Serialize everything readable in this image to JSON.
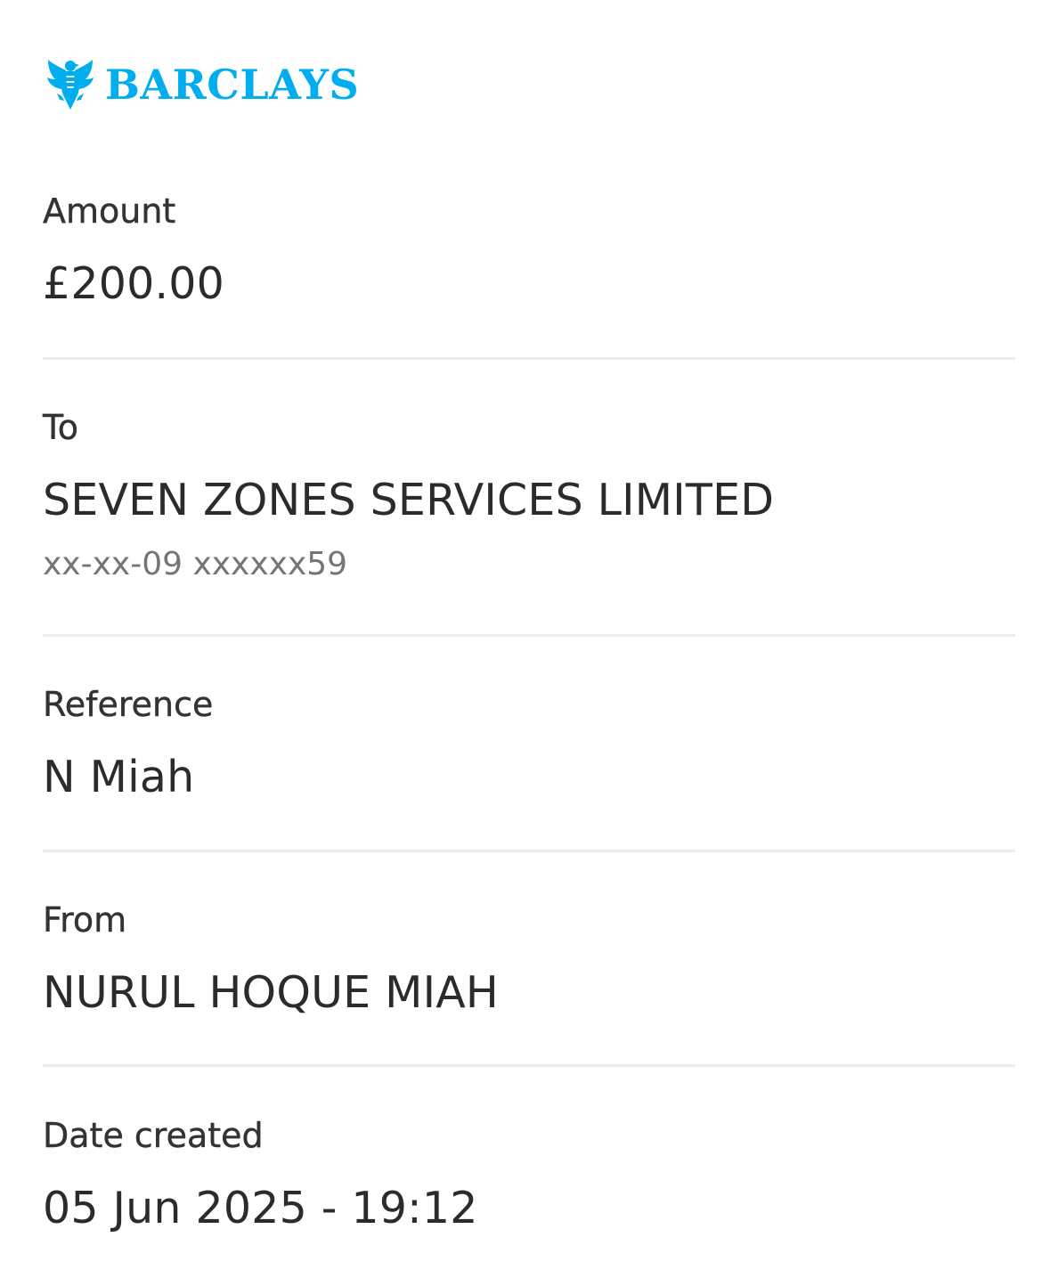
{
  "brand": {
    "name": "BARCLAYS",
    "color": "#00aeef",
    "icon": "eagle-logo-icon"
  },
  "fields": [
    {
      "label": "Amount",
      "value": "£200.00"
    },
    {
      "label": "To",
      "value": "SEVEN ZONES SERVICES LIMITED",
      "sub": "xx-xx-09 xxxxxx59"
    },
    {
      "label": "Reference",
      "value": "N Miah"
    },
    {
      "label": "From",
      "value": "NURUL HOQUE MIAH"
    },
    {
      "label": "Date created",
      "value": "05 Jun 2025 - 19:12"
    }
  ]
}
